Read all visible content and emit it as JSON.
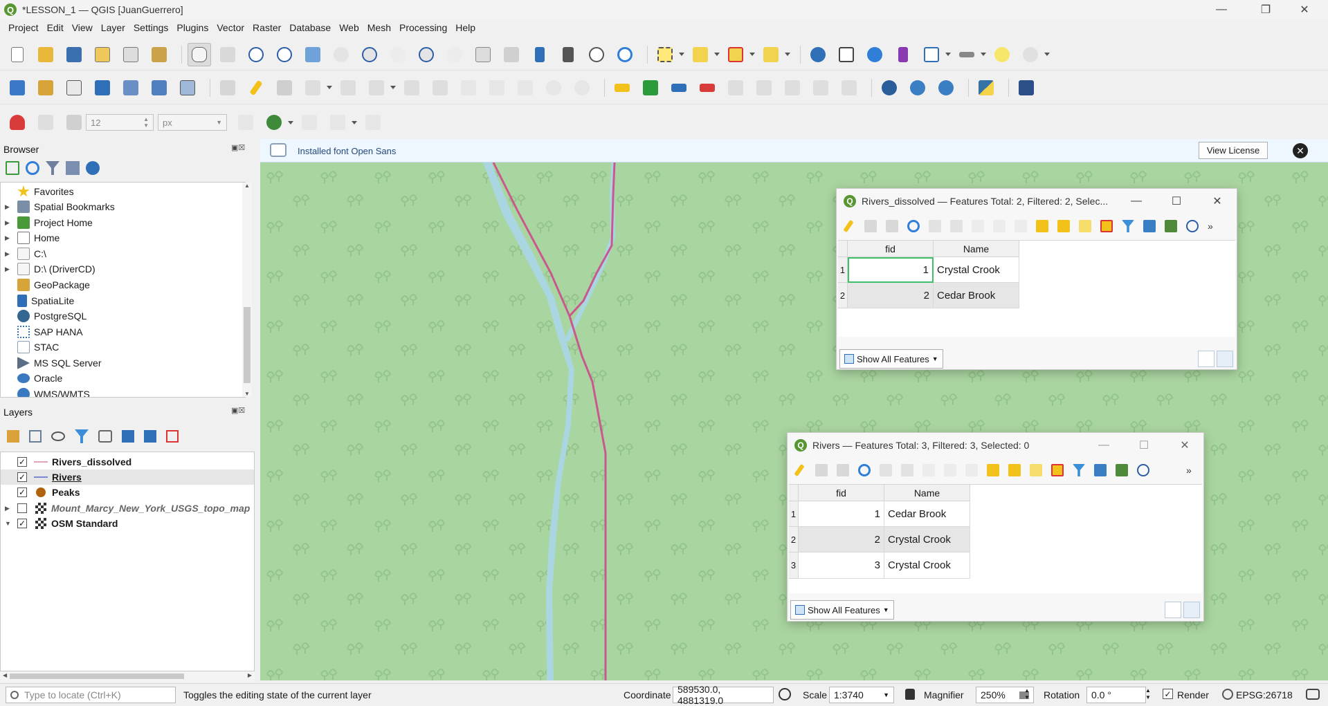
{
  "window": {
    "title": "*LESSON_1 — QGIS [JuanGuerrero]",
    "app_icon": "qgis-icon",
    "controls": [
      "minimize",
      "restore",
      "close"
    ]
  },
  "menu": [
    "Project",
    "Edit",
    "View",
    "Layer",
    "Settings",
    "Plugins",
    "Vector",
    "Raster",
    "Database",
    "Web",
    "Mesh",
    "Processing",
    "Help"
  ],
  "snapping": {
    "tolerance": "12",
    "unit": "px"
  },
  "message_bar": {
    "text": "Installed font Open Sans",
    "button": "View License"
  },
  "browser": {
    "title": "Browser",
    "items": [
      {
        "label": "Favorites",
        "icon": "star-icon",
        "color": "#f2c21a"
      },
      {
        "label": "Spatial Bookmarks",
        "icon": "bookmark-icon",
        "color": "#7a8fa6"
      },
      {
        "label": "Project Home",
        "icon": "project-home-icon",
        "color": "#4a9a3a"
      },
      {
        "label": "Home",
        "icon": "home-icon",
        "color": "#888888"
      },
      {
        "label": "C:\\",
        "icon": "drive-icon",
        "color": "#aaaaaa"
      },
      {
        "label": "D:\\ (DriverCD)",
        "icon": "drive-icon",
        "color": "#aaaaaa"
      },
      {
        "label": "GeoPackage",
        "icon": "geopackage-icon",
        "color": "#d7a43a"
      },
      {
        "label": "SpatiaLite",
        "icon": "spatialite-icon",
        "color": "#2f6fb7"
      },
      {
        "label": "PostgreSQL",
        "icon": "postgresql-icon",
        "color": "#336791"
      },
      {
        "label": "SAP HANA",
        "icon": "saphana-icon",
        "color": "#2f6fb7"
      },
      {
        "label": "STAC",
        "icon": "stac-icon",
        "color": "#8aa0b8"
      },
      {
        "label": "MS SQL Server",
        "icon": "mssql-icon",
        "color": "#5a6f86"
      },
      {
        "label": "Oracle",
        "icon": "oracle-icon",
        "color": "#3a78c0"
      },
      {
        "label": "WMS/WMTS",
        "icon": "wms-icon",
        "color": "#3a78c0"
      }
    ]
  },
  "layers": {
    "title": "Layers",
    "items": [
      {
        "label": "Rivers_dissolved",
        "checked": true,
        "symbol": "line",
        "color": "#e6a3b8",
        "bold": true
      },
      {
        "label": "Rivers",
        "checked": true,
        "symbol": "line",
        "color": "#7a86d6",
        "bold": true
      },
      {
        "label": "Peaks",
        "checked": true,
        "symbol": "point",
        "color": "#b0620f",
        "bold": true
      },
      {
        "label": "Mount_Marcy_New_York_USGS_topo_map",
        "checked": false,
        "symbol": "raster",
        "bold": false
      },
      {
        "label": "OSM Standard",
        "checked": true,
        "symbol": "raster",
        "bold": true
      }
    ]
  },
  "attr_table_1": {
    "title": "Rivers_dissolved — Features Total: 2, Filtered: 2, Selec...",
    "columns": [
      "fid",
      "Name"
    ],
    "rows": [
      {
        "num": "1",
        "fid": "1",
        "name": "Crystal Crook"
      },
      {
        "num": "2",
        "fid": "2",
        "name": "Cedar Brook"
      }
    ],
    "show_all": "Show All Features"
  },
  "attr_table_2": {
    "title": "Rivers — Features Total: 3, Filtered: 3, Selected: 0",
    "columns": [
      "fid",
      "Name"
    ],
    "rows": [
      {
        "num": "1",
        "fid": "1",
        "name": "Cedar Brook"
      },
      {
        "num": "2",
        "fid": "2",
        "name": "Crystal Crook"
      },
      {
        "num": "3",
        "fid": "3",
        "name": "Crystal Crook"
      }
    ],
    "show_all": "Show All Features"
  },
  "status": {
    "locate_placeholder": "Type to locate (Ctrl+K)",
    "message": "Toggles the editing state of the current layer",
    "coordinate_label": "Coordinate",
    "coordinate": "589530.0, 4881319.0",
    "scale_label": "Scale",
    "scale": "1:3740",
    "magnifier_label": "Magnifier",
    "magnifier": "250%",
    "rotation_label": "Rotation",
    "rotation": "0.0 °",
    "render_label": "Render",
    "crs": "EPSG:26718"
  },
  "colors": {
    "map_bg": "#a9d5a0",
    "river_line": "#c9588f",
    "river_water": "#a9d6e0",
    "qgis_green": "#589632",
    "selected_cell_border": "#3fbf6a"
  }
}
